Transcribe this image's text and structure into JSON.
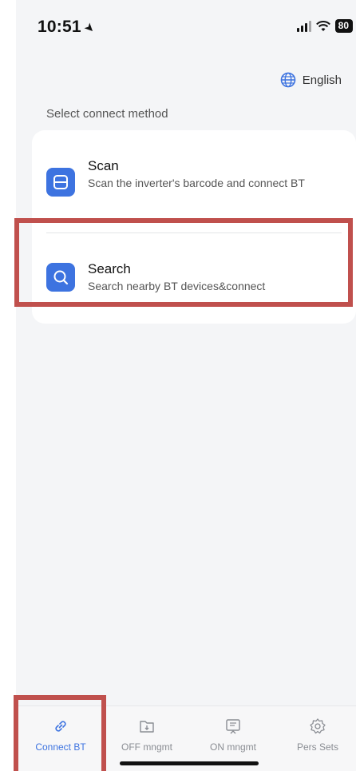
{
  "status_bar": {
    "time": "10:51",
    "battery": "80"
  },
  "language": {
    "label": "English"
  },
  "section_title": "Select connect method",
  "options": [
    {
      "title": "Scan",
      "description": "Scan the inverter's barcode and connect BT",
      "icon": "scan-icon"
    },
    {
      "title": "Search",
      "description": "Search nearby BT devices&connect",
      "icon": "search-icon"
    }
  ],
  "tabs": [
    {
      "label": "Connect BT",
      "icon": "link-icon",
      "active": true
    },
    {
      "label": "OFF mngmt",
      "icon": "folder-download-icon",
      "active": false
    },
    {
      "label": "ON mngmt",
      "icon": "upload-screen-icon",
      "active": false
    },
    {
      "label": "Pers Sets",
      "icon": "gear-icon",
      "active": false
    }
  ],
  "colors": {
    "accent": "#3d73e0",
    "highlight": "#c0504d",
    "background": "#f4f5f7"
  }
}
